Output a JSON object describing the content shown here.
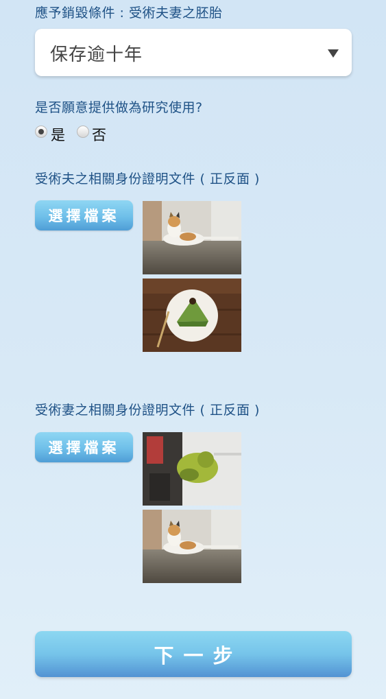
{
  "destroy_condition": {
    "label": "應予銷毀條件 : 受術夫妻之胚胎",
    "selected_value": "保存逾十年"
  },
  "research_consent": {
    "question": "是否願意提供做為研究使用?",
    "options": [
      {
        "label": "是",
        "checked": true
      },
      {
        "label": "否",
        "checked": false
      }
    ]
  },
  "husband_docs": {
    "label": "受術夫之相關身份證明文件 ( 正反面 )",
    "button_label": "選擇檔案",
    "thumbnails": [
      "cat-photo",
      "matcha-cake-photo"
    ]
  },
  "wife_docs": {
    "label": "受術妻之相關身份證明文件 ( 正反面 )",
    "button_label": "選擇檔案",
    "thumbnails": [
      "green-hat-photo",
      "cat-photo"
    ]
  },
  "next_button": {
    "label": "下一步"
  },
  "colors": {
    "label_text": "#1f5286",
    "button_gradient_top": "#8fd6f3",
    "button_gradient_bottom": "#4f9dd6"
  }
}
